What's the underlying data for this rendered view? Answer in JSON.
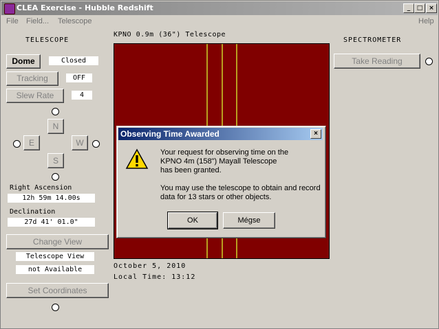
{
  "window": {
    "title": "CLEA Exercise - Hubble Redshift",
    "min": "_",
    "max": "□",
    "close": "×"
  },
  "menu": {
    "file": "File",
    "field": "Field...",
    "telescope": "Telescope",
    "help": "Help"
  },
  "telescope": {
    "heading": "TELESCOPE",
    "dome_label": "Dome",
    "dome_status": "Closed",
    "tracking_label": "Tracking",
    "tracking_status": "OFF",
    "slew_label": "Slew Rate",
    "slew_value": "4",
    "north": "N",
    "east": "E",
    "west": "W",
    "south": "S",
    "ra_label": "Right Ascension",
    "ra_value": "12h 59m 14.00s",
    "dec_label": "Declination",
    "dec_value": "27d 41' 01.0\"",
    "change_view_label": "Change View",
    "view_mode": "Telescope View",
    "availability": "not Available",
    "set_coordinates_label": "Set Coordinates"
  },
  "viewer": {
    "heading": "KPNO 0.9m (36\") Telescope",
    "date": "October 5, 2010",
    "local_time": "Local Time: 13:12"
  },
  "spectrometer": {
    "heading": "SPECTROMETER",
    "take_reading_label": "Take Reading"
  },
  "dialog": {
    "title": "Observing Time Awarded",
    "close": "×",
    "message": "Your request for observing time on the\nKPNO 4m (158\") Mayall Telescope\nhas been granted.\n\nYou may use the telescope to obtain and record\ndata for 13 stars or other objects.",
    "ok_label": "OK",
    "cancel_label": "Mégse"
  },
  "colors": {
    "view_bg": "#800000",
    "dialog_title": "#0a246a"
  }
}
